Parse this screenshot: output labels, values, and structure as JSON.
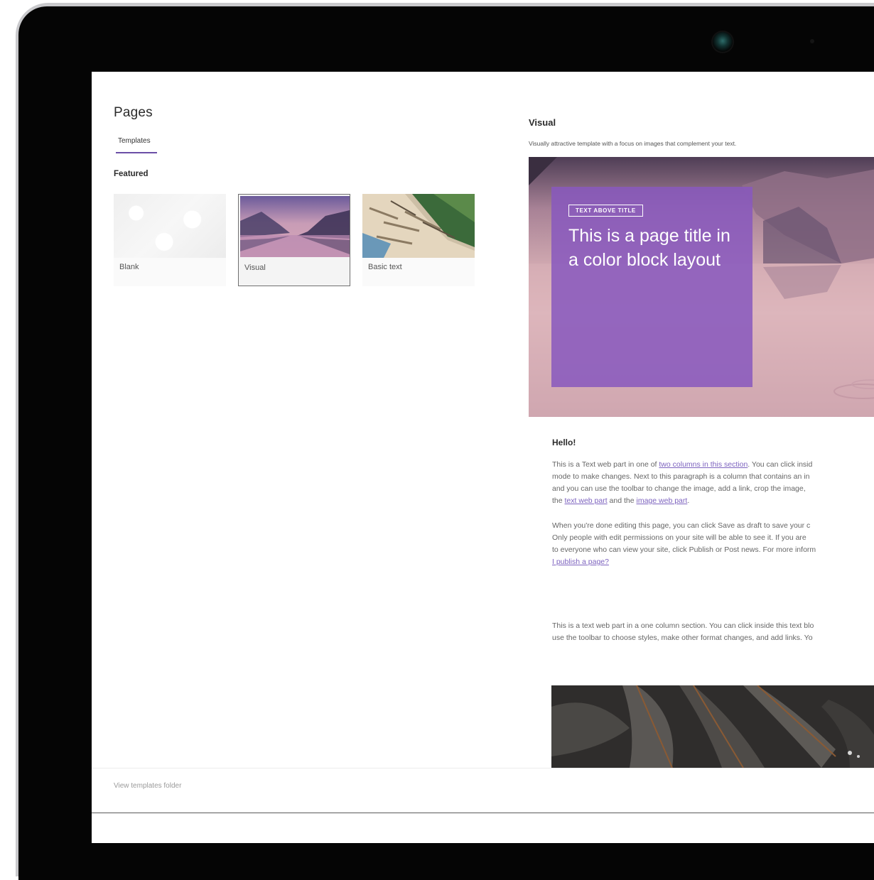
{
  "pages": {
    "title": "Pages",
    "tabs": [
      {
        "label": "Templates"
      }
    ],
    "section_title": "Featured",
    "templates": [
      {
        "label": "Blank"
      },
      {
        "label": "Visual"
      },
      {
        "label": "Basic text"
      }
    ],
    "footer_link": "View templates folder"
  },
  "preview": {
    "title": "Visual",
    "description": "Visually attractive template with a focus on images that complement your text.",
    "hero": {
      "tag": "TEXT ABOVE TITLE",
      "title_line1": "This is a page title in",
      "title_line2": "a color block layout"
    },
    "hello": "Hello!",
    "para1": {
      "l1a": "This is a Text web part in one of ",
      "l1link": "two columns in this section",
      "l1b": ". You can click insid",
      "l2": "mode to make changes. Next to this paragraph is a column that contains an in",
      "l3": "and you can use the toolbar to change the image, add a link, crop the image, ",
      "l4a": "the ",
      "l4link1": "text web part",
      "l4b": " and the ",
      "l4link2": "image web part",
      "l4c": "."
    },
    "para2": {
      "l1": "When you're done editing this page, you can click Save as draft to save your c",
      "l2": "Only people with edit permissions on your site will be able to see it. If you are",
      "l3": "to everyone who can view your site, click Publish or Post news. For more inform",
      "l4link": "I publish a page?"
    },
    "para3": {
      "l1": "This is a text web part in a one column section. You can click inside this text blo",
      "l2": "use the toolbar to choose styles, make other format changes, and add links. Yo"
    }
  }
}
